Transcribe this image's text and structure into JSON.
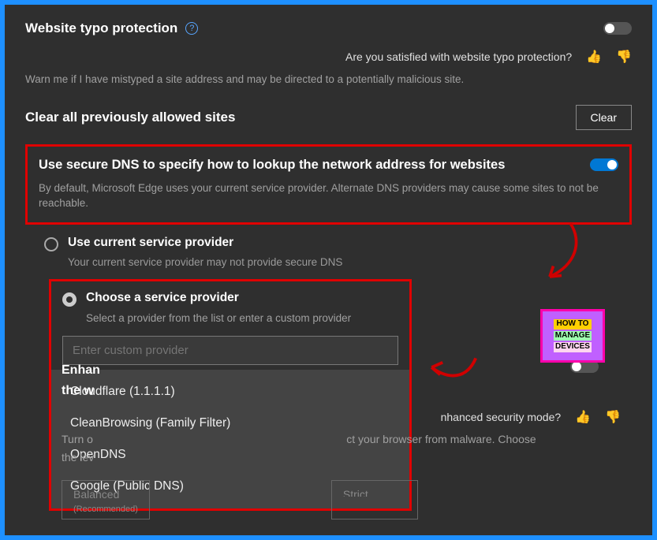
{
  "typo": {
    "title": "Website typo protection",
    "feedback_q": "Are you satisfied with website typo protection?",
    "desc": "Warn me if I have mistyped a site address and may be directed to a potentially malicious site."
  },
  "clear": {
    "title": "Clear all previously allowed sites",
    "button": "Clear"
  },
  "dns": {
    "title": "Use secure DNS to specify how to lookup the network address for websites",
    "desc": "By default, Microsoft Edge uses your current service provider. Alternate DNS providers may cause some sites to not be reachable.",
    "opt1_label": "Use current service provider",
    "opt1_sub": "Your current service provider may not provide secure DNS",
    "opt2_label": "Choose a service provider",
    "opt2_sub": "Select a provider from the list or enter a custom provider",
    "placeholder": "Enter custom provider",
    "providers": {
      "p0": "Cloudflare (1.1.1.1)",
      "p1": "CleanBrowsing (Family Filter)",
      "p2": "OpenDNS",
      "p3": "Google (Public DNS)"
    }
  },
  "enhance": {
    "title_left": "Enhan",
    "title_line2": "the w",
    "feedback_q": "nhanced security mode?",
    "desc_l1": "Turn o",
    "desc_l2": "the lev",
    "desc_r1": "ct your browser from malware. Choose",
    "balanced": "Balanced",
    "reco": "(Recommended)",
    "strict_partial": "Strict"
  },
  "logo": {
    "l1": "HOW TO",
    "l2": "MANAGE",
    "l3": "DEVICES"
  }
}
